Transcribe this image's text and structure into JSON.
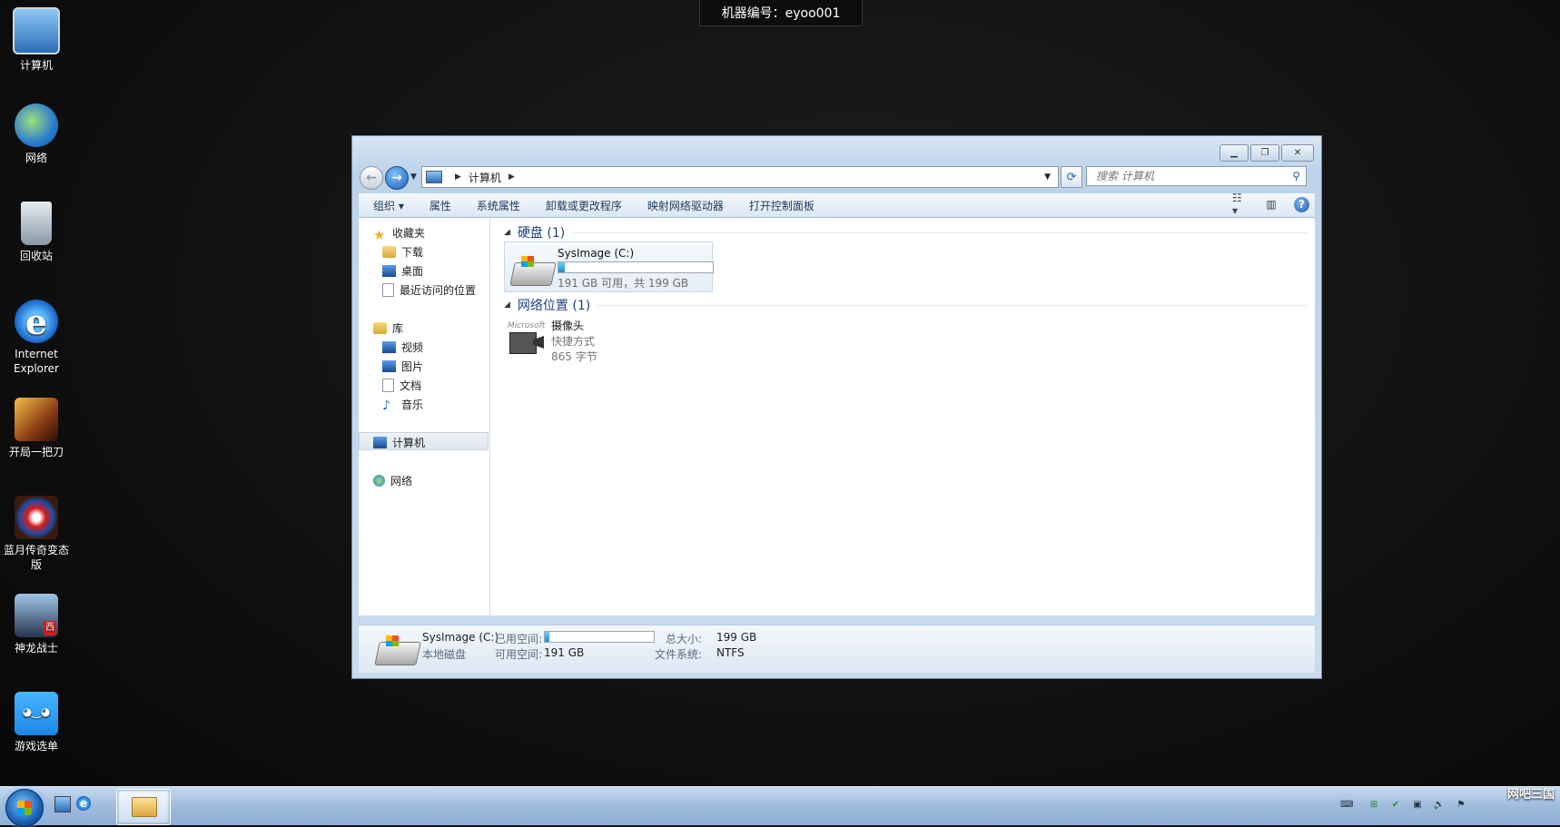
{
  "machine_badge": "机器编号：eyoo001",
  "desktop": {
    "icons": [
      {
        "label": "计算机",
        "icon": "computer-icon"
      },
      {
        "label": "网络",
        "icon": "network-icon"
      },
      {
        "label": "回收站",
        "icon": "recycle-bin-icon"
      },
      {
        "label": "Internet Explorer",
        "icon": "internet-explorer-icon"
      },
      {
        "label": "开局一把刀",
        "icon": "game-icon"
      },
      {
        "label": "蓝月传奇变态版",
        "icon": "game-icon"
      },
      {
        "label": "神龙战士",
        "icon": "game-icon"
      },
      {
        "label": "游戏选单",
        "icon": "game-menu-icon"
      }
    ]
  },
  "explorer": {
    "address": {
      "computer": "计算机"
    },
    "search_placeholder": "搜索 计算机",
    "toolbar": {
      "organize": "组织",
      "properties": "属性",
      "system_properties": "系统属性",
      "uninstall": "卸载或更改程序",
      "map_drive": "映射网络驱动器",
      "control_panel": "打开控制面板"
    },
    "nav": {
      "favorites": "收藏夹",
      "downloads": "下载",
      "desktop": "桌面",
      "recent": "最近访问的位置",
      "libraries": "库",
      "videos": "视频",
      "pictures": "图片",
      "documents": "文档",
      "music": "音乐",
      "computer": "计算机",
      "network": "网络"
    },
    "groups": {
      "hard_disks": "硬盘 (1)",
      "network_locations": "网络位置 (1)"
    },
    "drive": {
      "name": "SysImage (C:)",
      "free_text": "191 GB 可用，共 199 GB",
      "used_fraction": 0.04
    },
    "shortcut": {
      "name": "摄像头",
      "type": "快捷方式",
      "size": "865 字节"
    },
    "details": {
      "name": "SysImage (C:)",
      "type": "本地磁盘",
      "used_label": "已用空间:",
      "free_label": "可用空间:",
      "free_value": "191 GB",
      "total_label": "总大小:",
      "total_value": "199 GB",
      "fs_label": "文件系统:",
      "fs_value": "NTFS"
    }
  },
  "taskbar": {
    "brand": "网吧三国"
  },
  "colors": {
    "accent": "#1e3f87",
    "usage_bar": "#1f8fc9"
  }
}
